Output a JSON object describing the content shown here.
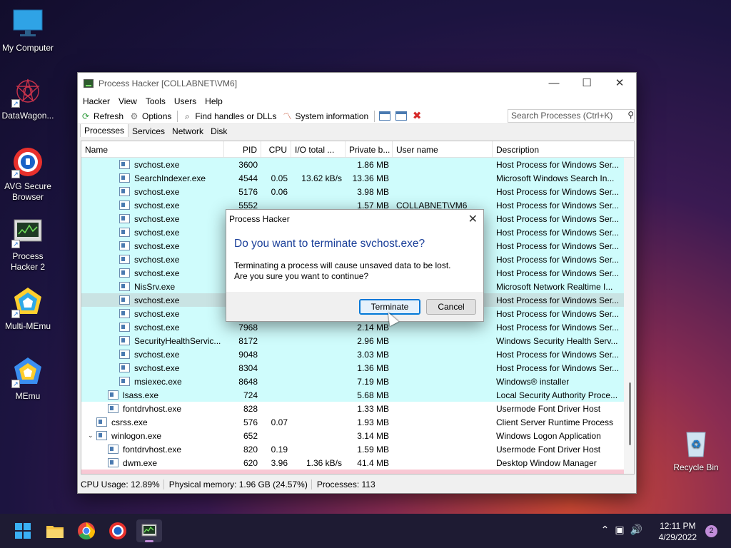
{
  "desktop": {
    "icons": [
      {
        "label": "My Computer"
      },
      {
        "label": "DataWagon..."
      },
      {
        "label": "AVG Secure Browser"
      },
      {
        "label": "Process Hacker 2"
      },
      {
        "label": "Multi-MEmu"
      },
      {
        "label": "MEmu"
      },
      {
        "label": "Recycle Bin"
      }
    ]
  },
  "window": {
    "title": "Process Hacker [COLLABNET\\VM6]",
    "controls": {
      "minimize": "—",
      "maximize": "☐",
      "close": "✕"
    },
    "menu": [
      "Hacker",
      "View",
      "Tools",
      "Users",
      "Help"
    ],
    "toolbar": {
      "refresh": "Refresh",
      "options": "Options",
      "find_handles": "Find handles or DLLs",
      "system_info": "System information",
      "search_placeholder": "Search Processes (Ctrl+K)"
    },
    "tabs": [
      "Processes",
      "Services",
      "Network",
      "Disk"
    ],
    "columns": [
      "Name",
      "PID",
      "CPU",
      "I/O total ...",
      "Private b...",
      "User name",
      "Description"
    ],
    "rows": [
      {
        "indent": 3,
        "name": "svchost.exe",
        "pid": "3600",
        "cpu": "",
        "io": "",
        "priv": "1.86 MB",
        "user": "",
        "desc": "Host Process for Windows Ser...",
        "style": "cyan"
      },
      {
        "indent": 3,
        "name": "SearchIndexer.exe",
        "pid": "4544",
        "cpu": "0.05",
        "io": "13.62 kB/s",
        "priv": "13.36 MB",
        "user": "",
        "desc": "Microsoft Windows Search In...",
        "style": "cyan"
      },
      {
        "indent": 3,
        "name": "svchost.exe",
        "pid": "5176",
        "cpu": "0.06",
        "io": "",
        "priv": "3.98 MB",
        "user": "",
        "desc": "Host Process for Windows Ser...",
        "style": "cyan"
      },
      {
        "indent": 3,
        "name": "svchost.exe",
        "pid": "5552",
        "cpu": "",
        "io": "",
        "priv": "1.57 MB",
        "user": "COLLABNET\\VM6",
        "desc": "Host Process for Windows Ser...",
        "style": "cyan"
      },
      {
        "indent": 3,
        "name": "svchost.exe",
        "pid": "",
        "cpu": "",
        "io": "",
        "priv": "",
        "user": "",
        "desc": "Host Process for Windows Ser...",
        "style": "cyan"
      },
      {
        "indent": 3,
        "name": "svchost.exe",
        "pid": "",
        "cpu": "",
        "io": "",
        "priv": "",
        "user": "",
        "desc": "Host Process for Windows Ser...",
        "style": "cyan"
      },
      {
        "indent": 3,
        "name": "svchost.exe",
        "pid": "",
        "cpu": "",
        "io": "",
        "priv": "",
        "user": "",
        "desc": "Host Process for Windows Ser...",
        "style": "cyan"
      },
      {
        "indent": 3,
        "name": "svchost.exe",
        "pid": "",
        "cpu": "",
        "io": "",
        "priv": "",
        "user": "",
        "desc": "Host Process for Windows Ser...",
        "style": "cyan"
      },
      {
        "indent": 3,
        "name": "svchost.exe",
        "pid": "",
        "cpu": "",
        "io": "",
        "priv": "",
        "user": "",
        "desc": "Host Process for Windows Ser...",
        "style": "cyan"
      },
      {
        "indent": 3,
        "name": "NisSrv.exe",
        "pid": "",
        "cpu": "",
        "io": "",
        "priv": "",
        "user": "",
        "desc": "Microsoft Network Realtime I...",
        "style": "cyan"
      },
      {
        "indent": 3,
        "name": "svchost.exe",
        "pid": "",
        "cpu": "",
        "io": "",
        "priv": "",
        "user": "",
        "desc": "Host Process for Windows Ser...",
        "style": "sel"
      },
      {
        "indent": 3,
        "name": "svchost.exe",
        "pid": "",
        "cpu": "",
        "io": "",
        "priv": "",
        "user": "",
        "desc": "Host Process for Windows Ser...",
        "style": "cyan"
      },
      {
        "indent": 3,
        "name": "svchost.exe",
        "pid": "7968",
        "cpu": "",
        "io": "",
        "priv": "2.14 MB",
        "user": "",
        "desc": "Host Process for Windows Ser...",
        "style": "cyan"
      },
      {
        "indent": 3,
        "name": "SecurityHealthServic...",
        "pid": "8172",
        "cpu": "",
        "io": "",
        "priv": "2.96 MB",
        "user": "",
        "desc": "Windows Security Health Serv...",
        "style": "cyan"
      },
      {
        "indent": 3,
        "name": "svchost.exe",
        "pid": "9048",
        "cpu": "",
        "io": "",
        "priv": "3.03 MB",
        "user": "",
        "desc": "Host Process for Windows Ser...",
        "style": "cyan"
      },
      {
        "indent": 3,
        "name": "svchost.exe",
        "pid": "8304",
        "cpu": "",
        "io": "",
        "priv": "1.36 MB",
        "user": "",
        "desc": "Host Process for Windows Ser...",
        "style": "cyan"
      },
      {
        "indent": 3,
        "name": "msiexec.exe",
        "pid": "8648",
        "cpu": "",
        "io": "",
        "priv": "7.19 MB",
        "user": "",
        "desc": "Windows® installer",
        "style": "cyan"
      },
      {
        "indent": 2,
        "name": "lsass.exe",
        "pid": "724",
        "cpu": "",
        "io": "",
        "priv": "5.68 MB",
        "user": "",
        "desc": "Local Security Authority Proce...",
        "style": "cyan"
      },
      {
        "indent": 2,
        "name": "fontdrvhost.exe",
        "pid": "828",
        "cpu": "",
        "io": "",
        "priv": "1.33 MB",
        "user": "",
        "desc": "Usermode Font Driver Host",
        "style": ""
      },
      {
        "indent": 1,
        "name": "csrss.exe",
        "pid": "576",
        "cpu": "0.07",
        "io": "",
        "priv": "1.93 MB",
        "user": "",
        "desc": "Client Server Runtime Process",
        "style": ""
      },
      {
        "indent": 1,
        "name": "winlogon.exe",
        "pid": "652",
        "cpu": "",
        "io": "",
        "priv": "3.14 MB",
        "user": "",
        "desc": "Windows Logon Application",
        "style": "",
        "expander": "⌄"
      },
      {
        "indent": 2,
        "name": "fontdrvhost.exe",
        "pid": "820",
        "cpu": "0.19",
        "io": "",
        "priv": "1.59 MB",
        "user": "",
        "desc": "Usermode Font Driver Host",
        "style": ""
      },
      {
        "indent": 2,
        "name": "dwm.exe",
        "pid": "620",
        "cpu": "3.96",
        "io": "1.36 kB/s",
        "priv": "41.4 MB",
        "user": "",
        "desc": "Desktop Window Manager",
        "style": ""
      },
      {
        "indent": 1,
        "name": "",
        "pid": "",
        "cpu": "",
        "io": "",
        "priv": "",
        "user": "",
        "desc": "",
        "style": "pink"
      }
    ],
    "status": {
      "cpu": "CPU Usage: 12.89%",
      "memory": "Physical memory: 1.96 GB (24.57%)",
      "processes": "Processes: 113"
    }
  },
  "dialog": {
    "title": "Process Hacker",
    "heading": "Do you want to terminate svchost.exe?",
    "body": "Terminating a process will cause unsaved data to be lost. Are you sure you want to continue?",
    "terminate_label": "Terminate",
    "cancel_label": "Cancel"
  },
  "taskbar": {
    "time": "12:11 PM",
    "date": "4/29/2022",
    "notifications": "2"
  }
}
